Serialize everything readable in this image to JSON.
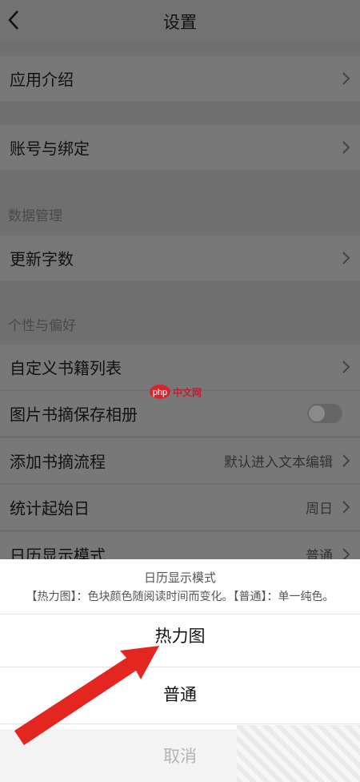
{
  "header": {
    "title": "设置"
  },
  "rows": {
    "app_intro": "应用介绍",
    "account": "账号与绑定",
    "update_words": "更新字数",
    "custom_list": "自定义书籍列表",
    "save_album": "图片书摘保存相册",
    "add_flow": {
      "label": "添加书摘流程",
      "value": "默认进入文本编辑"
    },
    "start_day": {
      "label": "统计起始日",
      "value": "周日"
    },
    "calendar_mode": {
      "label": "日历显示模式",
      "value": "普通"
    }
  },
  "sections": {
    "data_mgmt": "数据管理",
    "personal": "个性与偏好"
  },
  "watermark": {
    "text": "中文网",
    "logo": "php"
  },
  "sheet": {
    "title": "日历显示模式",
    "description": "【热力图】：色块颜色随阅读时间而变化。【普通】：单一纯色。",
    "options": [
      "热力图",
      "普通"
    ],
    "cancel": "取消"
  },
  "colors": {
    "arrow": "#e3261f",
    "overlay": "#6f6f6f"
  },
  "toggle_save_album": false
}
